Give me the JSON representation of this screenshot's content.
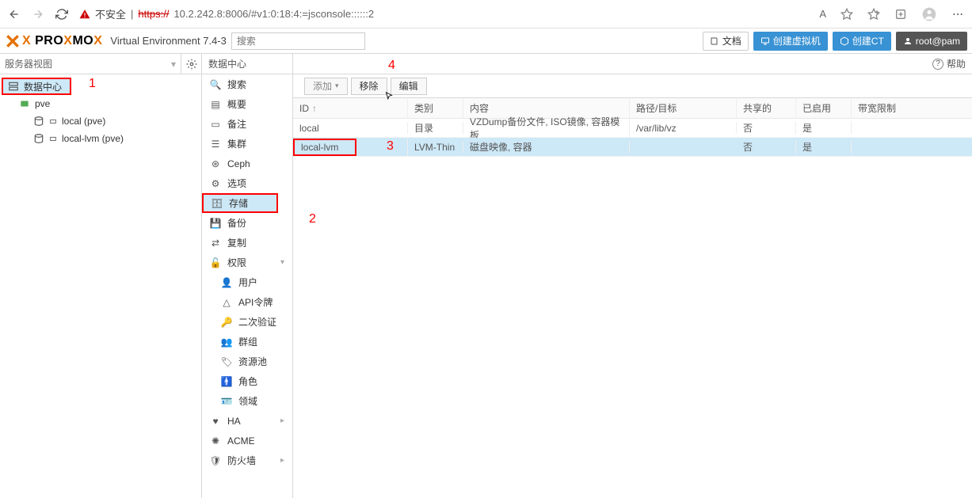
{
  "browser": {
    "insecure_label": "不安全",
    "url_scheme": "https://",
    "url_rest": "10.2.242.8:8006/#v1:0:18:4:=jsconsole::::::2",
    "font_indicator": "A"
  },
  "header": {
    "logo_main": "PRO",
    "logo_mid": "MO",
    "ve": "Virtual Environment 7.4-3",
    "search_placeholder": "搜索",
    "buttons": {
      "docs": "文档",
      "create_vm": "创建虚拟机",
      "create_ct": "创建CT",
      "user": "root@pam"
    }
  },
  "left": {
    "view_label": "服务器视图",
    "tree": {
      "datacenter": "数据中心",
      "node": "pve",
      "storage1": "local (pve)",
      "storage2": "local-lvm (pve)"
    }
  },
  "breadcrumb": "数据中心",
  "menu": {
    "search": "搜索",
    "summary": "概要",
    "notes": "备注",
    "cluster": "集群",
    "ceph": "Ceph",
    "options": "选项",
    "storage": "存储",
    "backup": "备份",
    "replication": "复制",
    "permissions": "权限",
    "users": "用户",
    "api_tokens": "API令牌",
    "tfa": "二次验证",
    "groups": "群组",
    "pools": "资源池",
    "roles": "角色",
    "realms": "领域",
    "ha": "HA",
    "acme": "ACME",
    "firewall": "防火墙"
  },
  "toolbar": {
    "add": "添加",
    "remove": "移除",
    "edit": "编辑"
  },
  "help_label": "帮助",
  "columns": {
    "id": "ID",
    "type": "类别",
    "content": "内容",
    "path": "路径/目标",
    "shared": "共享的",
    "enabled": "已启用",
    "bw": "带宽限制"
  },
  "rows": [
    {
      "id": "local",
      "type": "目录",
      "content": "VZDump备份文件, ISO镜像, 容器模板",
      "path": "/var/lib/vz",
      "shared": "否",
      "enabled": "是"
    },
    {
      "id": "local-lvm",
      "type": "LVM-Thin",
      "content": "磁盘映像, 容器",
      "path": "",
      "shared": "否",
      "enabled": "是"
    }
  ],
  "annotations": {
    "a1": "1",
    "a2": "2",
    "a3": "3",
    "a4": "4"
  }
}
